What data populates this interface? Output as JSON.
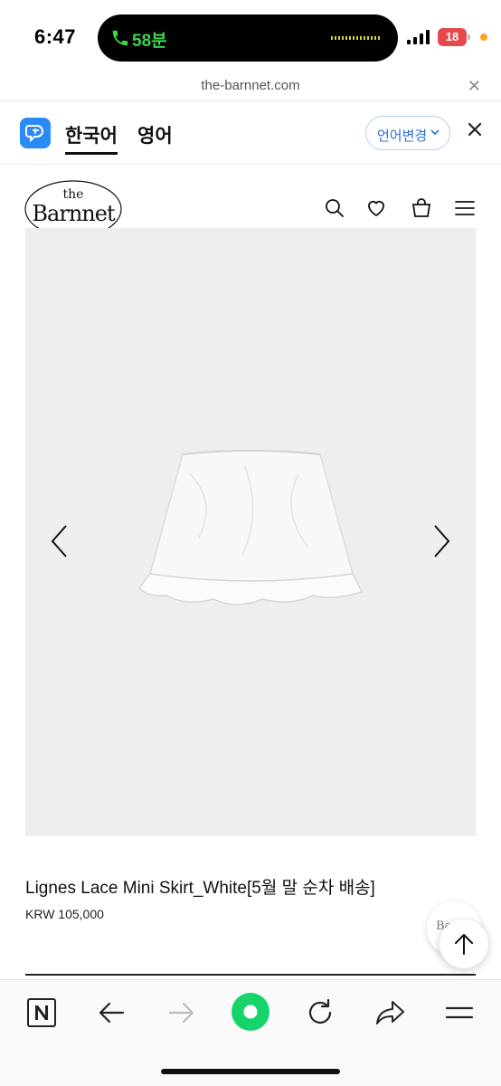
{
  "status_bar": {
    "time": "6:47",
    "call_duration": "58분",
    "battery_level": "18",
    "call_color": "#3fd24b",
    "battery_color": "#e5484d"
  },
  "browser": {
    "url": "the-barnnet.com",
    "close_icon": "close-icon"
  },
  "translate_bar": {
    "tab_korean": "한국어",
    "tab_english": "영어",
    "change_language": "언어변경",
    "accent_color": "#2a8af6"
  },
  "site": {
    "logo_the": "the",
    "logo_name": "Barnnet",
    "icons": [
      "search-icon",
      "heart-icon",
      "bag-icon",
      "menu-icon"
    ]
  },
  "product": {
    "name": "Lignes Lace Mini Skirt_White[5월 말 순차 배송]",
    "price": "KRW 105,000",
    "image_bg": "#eeeeec"
  },
  "floating": {
    "chat_logo": "Ba"
  },
  "bottom_nav": {
    "icons": [
      "naver-icon",
      "back-arrow-icon",
      "forward-arrow-icon",
      "green-circle-icon",
      "reload-icon",
      "share-icon",
      "menu-icon"
    ],
    "accent_color": "#16d46a"
  }
}
